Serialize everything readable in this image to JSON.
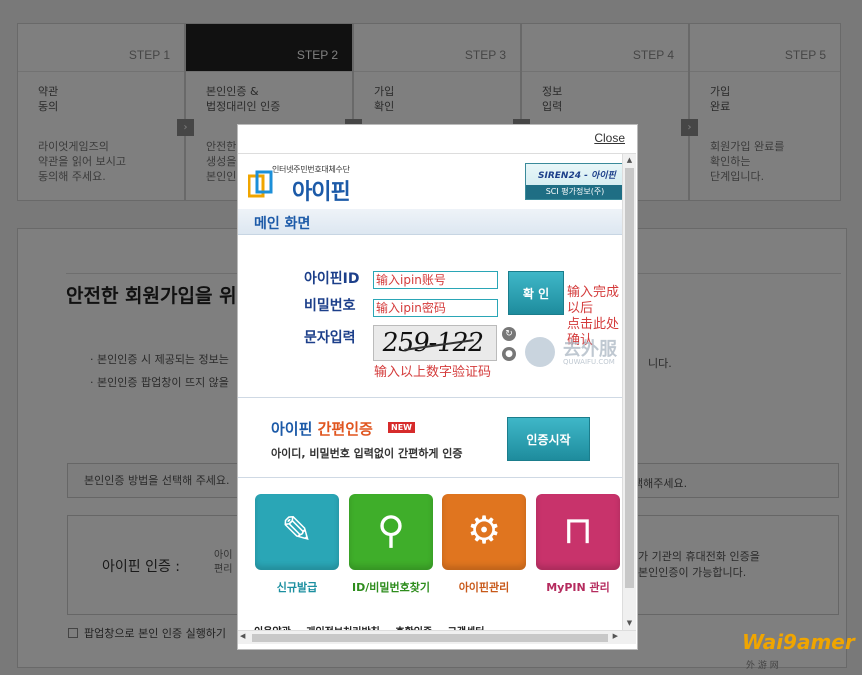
{
  "steps": [
    {
      "no": "STEP 1",
      "title": "약관\n동의",
      "desc": "라이엇게임즈의\n약관을 읽어 보시고\n동의해 주세요."
    },
    {
      "no": "STEP 2",
      "title": "본인인증 &\n법정대리인 인증",
      "desc": "안전한\n생성을\n본인인"
    },
    {
      "no": "STEP 3",
      "title": "가입\n확인",
      "desc": ""
    },
    {
      "no": "STEP 4",
      "title": "정보\n입력",
      "desc": ""
    },
    {
      "no": "STEP 5",
      "title": "가입\n완료",
      "desc": "회원가입 완료를\n확인하는\n단계입니다."
    }
  ],
  "background": {
    "headline": "안전한 회원가입을 위",
    "notice_1": "· 본인인증 시 제공되는 정보는",
    "notice_2": "· 본인인증 팝업창이 뜨지 않을",
    "notice_right": "니다.",
    "method_box": "본인인증 방법을 선택해 주세요.",
    "method_box_right": "택해주세요.",
    "ipin_label": "아이핀 인증 :",
    "ipin_sub": "아이\n편리",
    "ipin_right": "가 기관의 휴대전화 인증을\n본인인증이 가능합니다.",
    "popup_check": "팝업창으로 본인 인증 실행하기"
  },
  "popup": {
    "close": "Close",
    "logo_small": "인터넷주민번호대체수단",
    "logo_big": "아이핀",
    "siren_top": "SIREN24 - 아이핀",
    "siren_bottom": "SCI 평가정보(주)",
    "main_tab": "메인 화면",
    "login": {
      "id_label": "아이핀ID",
      "pw_label": "비밀번호",
      "captcha_label": "문자입력",
      "id_placeholder": "输入ipin账号",
      "pw_placeholder": "输入ipin密码",
      "captcha_text": "259-122",
      "confirm": "확 인",
      "annot_confirm": "输入完成以后\n点击此处确认",
      "annot_captcha": "输入以上数字验证码",
      "refresh_icon": "↻",
      "audio_icon": "●"
    },
    "watermark": {
      "text": "去外服",
      "sub": "QUWAIFU.COM"
    },
    "simple_auth": {
      "title_a": "아이핀 ",
      "title_b": "간편인증",
      "badge": "NEW",
      "desc": "아이디, 비밀번호 입력없이 간편하게 인증",
      "button": "인증시작"
    },
    "menu": [
      {
        "label": "신규발급",
        "color": "#2aa6b6",
        "label_color": "#1c8fa0",
        "glyph": "✎"
      },
      {
        "label": "ID/비밀번호찾기",
        "color": "#3fae2a",
        "label_color": "#2e8d1d",
        "glyph": "⚲"
      },
      {
        "label": "아이핀관리",
        "color": "#e0751f",
        "label_color": "#c8591a",
        "glyph": "⚙"
      },
      {
        "label": "MyPIN 관리",
        "color": "#c8336b",
        "label_color": "#b52b5e",
        "glyph": "🔓"
      }
    ],
    "bottom_links": "이용약관 개인정보처리방침 호환인증 고객센터"
  },
  "brand": {
    "name": "Wai9amer",
    "sub": "外 游 网"
  }
}
